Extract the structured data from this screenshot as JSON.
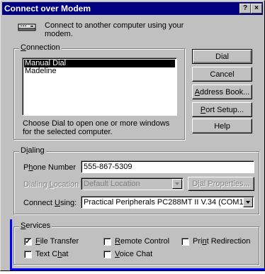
{
  "window": {
    "title": "Connect over Modem",
    "help_glyph": "?",
    "close_glyph": "×"
  },
  "intro": {
    "text": "Connect to another computer using your modem.",
    "icon": "modem-icon"
  },
  "connection": {
    "group_label": "Connection",
    "items": [
      "Manual Dial",
      "Madeline"
    ],
    "selected_index": 0,
    "description": "Choose Dial to open one or more windows for the selected computer."
  },
  "buttons": {
    "dial": "Dial",
    "cancel": "Cancel",
    "address_book": "Address Book...",
    "port_setup": "Port Setup...",
    "help": "Help"
  },
  "dialing": {
    "group_label": "Dialing",
    "phone_label": "Phone Number",
    "phone_value": "555-867-5309",
    "location_label": "Dialing Location",
    "location_value": "Default Location",
    "dial_properties": "Dial Properties...",
    "connect_label": "Connect Using:",
    "connect_value": "Practical Peripherals PC288MT II V.34 (COM1)"
  },
  "services": {
    "group_label": "Services",
    "file_transfer": {
      "label": "File Transfer",
      "checked": true
    },
    "remote_control": {
      "label": "Remote Control",
      "checked": false
    },
    "print_redirection": {
      "label": "Print Redirection",
      "checked": false
    },
    "text_chat": {
      "label": "Text Chat",
      "checked": false
    },
    "voice_chat": {
      "label": "Voice Chat",
      "checked": false
    }
  }
}
